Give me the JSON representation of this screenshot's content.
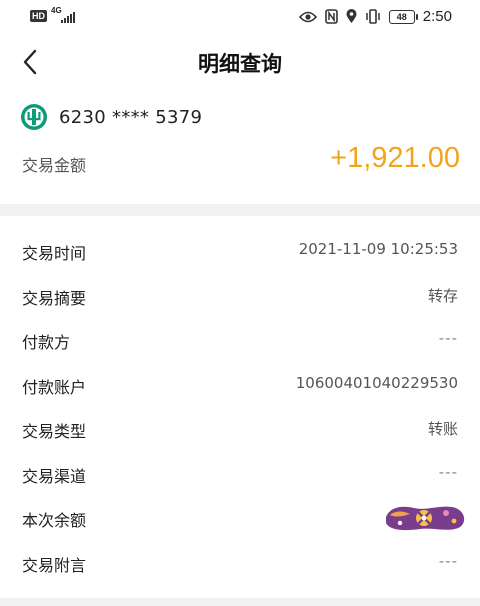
{
  "statusbar": {
    "hd": "HD",
    "network": "4G",
    "battery": "48",
    "time": "2:50"
  },
  "nav": {
    "title": "明细查询",
    "back_icon": "chevron-left-icon"
  },
  "account": {
    "bank_icon": "abc-bank-logo-icon",
    "card_number": "6230 **** 5379"
  },
  "amount": {
    "label": "交易金额",
    "value": "+1,921.00",
    "color": "#f2a51a"
  },
  "details": [
    {
      "label": "交易时间",
      "value": "2021-11-09 10:25:53"
    },
    {
      "label": "交易摘要",
      "value": "转存"
    },
    {
      "label": "付款方",
      "value": "---"
    },
    {
      "label": "付款账户",
      "value": "10600401040229530"
    },
    {
      "label": "交易类型",
      "value": "转账"
    },
    {
      "label": "交易渠道",
      "value": "---"
    },
    {
      "label": "本次余额",
      "value": ""
    },
    {
      "label": "交易附言",
      "value": "---"
    }
  ],
  "colors": {
    "accent": "#f2a51a",
    "bank_green": "#0e9b7a",
    "divider": "#f1f1f3"
  }
}
